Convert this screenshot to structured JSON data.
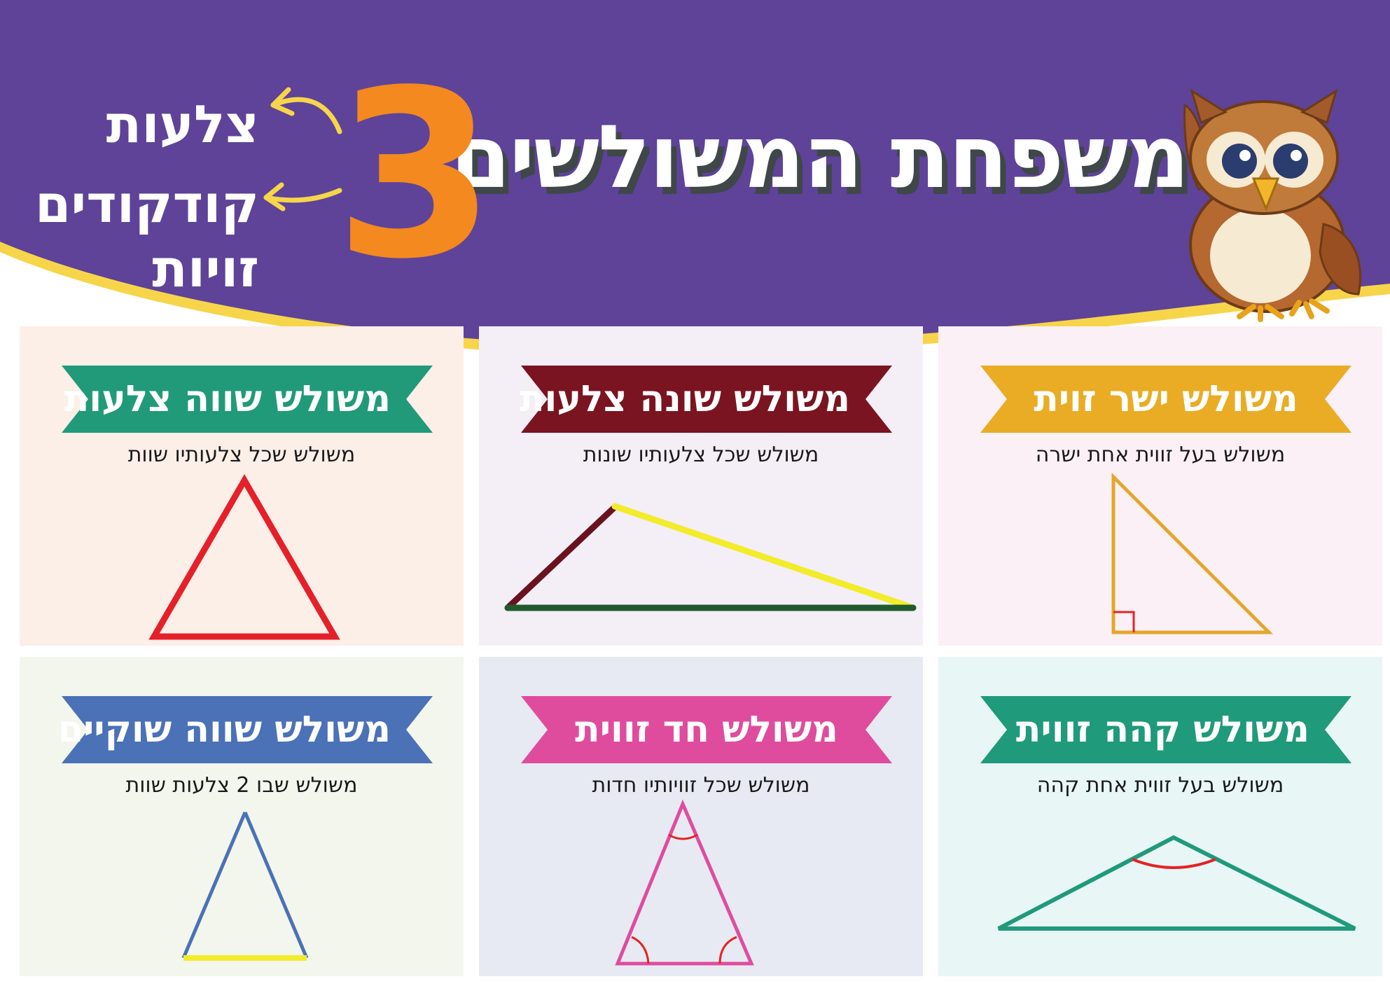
{
  "header": {
    "title": "משפחת המשולשים",
    "number": "3",
    "words": [
      "צלעות",
      "קודקודים",
      "זויות"
    ],
    "colors": {
      "background": "#5e4399",
      "wave": "#f7d54a",
      "number": "#f3891f"
    }
  },
  "cards": [
    {
      "title": "משולש ישר זוית",
      "description": "משולש בעל זווית אחת ישרה",
      "ribbon_color": "#e9ac24",
      "background": "#fbf0f5"
    },
    {
      "title": "משולש שונה צלעות",
      "description": "משולש שכל צלעותיו שונות",
      "ribbon_color": "#7b1421",
      "background": "#f4eef6"
    },
    {
      "title": "משולש שווה צלעות",
      "description": "משולש שכל צלעותיו שוות",
      "ribbon_color": "#219a7a",
      "background": "#fcefe8"
    },
    {
      "title": "משולש קהה זווית",
      "description": "משולש בעל זווית אחת קהה",
      "ribbon_color": "#1f9a7b",
      "background": "#e8f6f6"
    },
    {
      "title": "משולש חד זווית",
      "description": "משולש שכל זוויותיו חדות",
      "ribbon_color": "#df4c9e",
      "background": "#e7eaf2"
    },
    {
      "title": "משולש שווה שוקיים",
      "description": "משולש שבו 2 צלעות שוות",
      "ribbon_color": "#4b71b7",
      "background": "#f3f6ec"
    }
  ]
}
